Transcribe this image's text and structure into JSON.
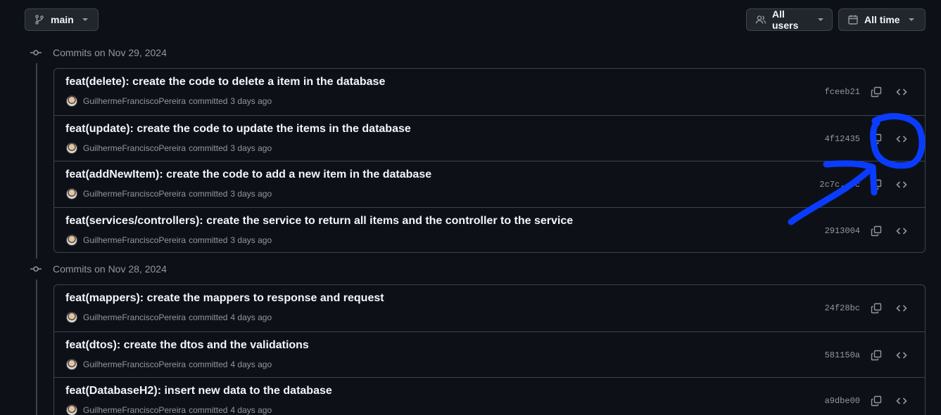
{
  "branch_button": {
    "label": "main",
    "icon": "git-branch-icon"
  },
  "users_button": {
    "label": "All users",
    "icon": "people-icon"
  },
  "time_button": {
    "label": "All time",
    "icon": "calendar-icon"
  },
  "groups": [
    {
      "heading": "Commits on Nov 29, 2024",
      "commits": [
        {
          "title": "feat(delete): create the code to delete a item in the database",
          "author": "GuilhermeFranciscoPereira",
          "verb": "committed",
          "time": "3 days ago",
          "sha": "fceeb21"
        },
        {
          "title": "feat(update): create the code to update the items in the database",
          "author": "GuilhermeFranciscoPereira",
          "verb": "committed",
          "time": "3 days ago",
          "sha": "4f12435"
        },
        {
          "title": "feat(addNewItem): create the code to add a new item in the database",
          "author": "GuilhermeFranciscoPereira",
          "verb": "committed",
          "time": "3 days ago",
          "sha": "2c7c...c"
        },
        {
          "title": "feat(services/controllers): create the service to return all items and the controller to the service",
          "author": "GuilhermeFranciscoPereira",
          "verb": "committed",
          "time": "3 days ago",
          "sha": "2913004"
        }
      ]
    },
    {
      "heading": "Commits on Nov 28, 2024",
      "commits": [
        {
          "title": "feat(mappers): create the mappers to response and request",
          "author": "GuilhermeFranciscoPereira",
          "verb": "committed",
          "time": "4 days ago",
          "sha": "24f28bc"
        },
        {
          "title": "feat(dtos): create the dtos and the validations",
          "author": "GuilhermeFranciscoPereira",
          "verb": "committed",
          "time": "4 days ago",
          "sha": "581150a"
        },
        {
          "title": "feat(DatabaseH2): insert new data to the database",
          "author": "GuilhermeFranciscoPereira",
          "verb": "committed",
          "time": "4 days ago",
          "sha": "a9dbe00"
        }
      ]
    }
  ],
  "colors": {
    "background": "#0d1117",
    "border": "#3d444d",
    "text_primary": "#f0f6fc",
    "text_muted": "#9198a1",
    "annotation": "#0a3cff"
  },
  "annotation": {
    "shape": "hand-drawn circle with arrow",
    "target": "browse-repository-icon of second commit"
  }
}
